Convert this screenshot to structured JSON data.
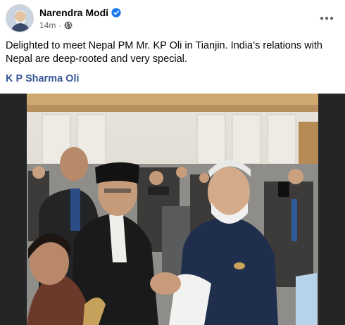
{
  "post": {
    "author": "Narendra Modi",
    "timestamp": "14m",
    "privacy_icon": "globe-icon",
    "verified_icon": "verified-badge-icon",
    "more_icon": "more-horizontal-icon",
    "text": "Delighted to meet Nepal PM Mr. KP Oli in Tianjin. India’s relations with Nepal are deep-rooted and very special.",
    "tag": "K P Sharma Oli"
  },
  "colors": {
    "verified": "#1877f2",
    "link": "#385898",
    "meta": "#65676b",
    "media_frame": "#242526"
  }
}
